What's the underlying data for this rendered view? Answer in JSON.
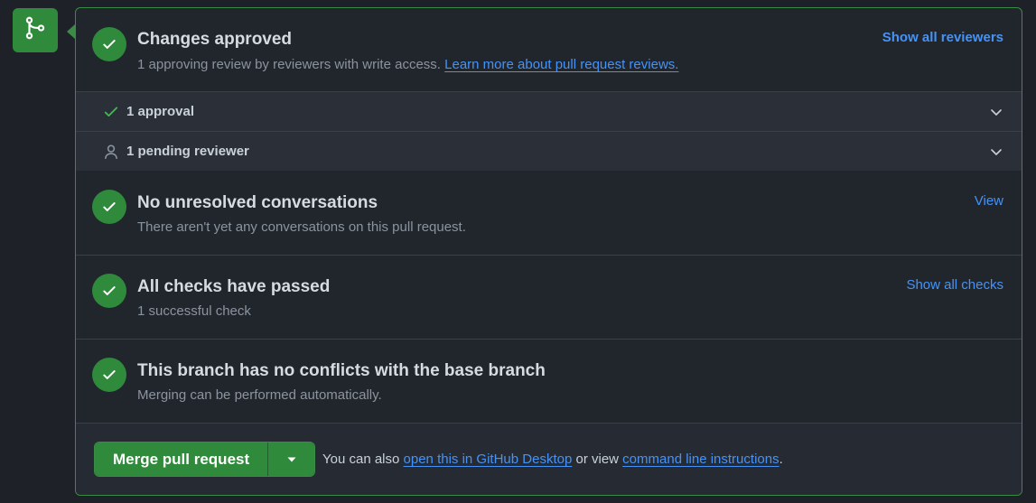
{
  "icons": {
    "merge_badge": "git-merge-icon",
    "check": "check-icon",
    "person": "person-icon",
    "chevron": "chevron-down-icon",
    "triangle": "triangle-down-icon"
  },
  "colors": {
    "success": "#2f8a3c",
    "link": "#4493f8",
    "panel_border": "#3c8a47"
  },
  "approvals": {
    "title": "Changes approved",
    "subtitle_prefix": "1 approving review by reviewers with write access. ",
    "subtitle_link": "Learn more about pull request reviews.",
    "action": "Show all reviewers",
    "rows": [
      {
        "label": "1 approval",
        "icon": "check-icon"
      },
      {
        "label": "1 pending reviewer",
        "icon": "person-icon"
      }
    ]
  },
  "conversations": {
    "title": "No unresolved conversations",
    "subtitle": "There aren't yet any conversations on this pull request.",
    "action": "View"
  },
  "checks": {
    "title": "All checks have passed",
    "subtitle": "1 successful check",
    "action": "Show all checks"
  },
  "conflicts": {
    "title": "This branch has no conflicts with the base branch",
    "subtitle": "Merging can be performed automatically."
  },
  "footer": {
    "merge_label": "Merge pull request",
    "text_prefix": "You can also ",
    "desktop_link": "open this in GitHub Desktop",
    "text_middle": " or view ",
    "cli_link": "command line instructions",
    "text_suffix": "."
  }
}
